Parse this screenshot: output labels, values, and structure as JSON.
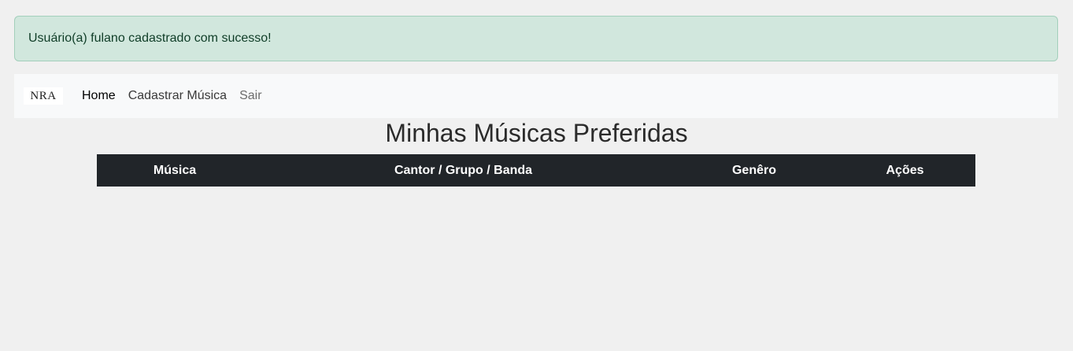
{
  "alert": {
    "message": "Usuário(a) fulano cadastrado com sucesso!"
  },
  "navbar": {
    "brand": "NRA",
    "links": [
      {
        "label": "Home"
      },
      {
        "label": "Cadastrar Música"
      },
      {
        "label": "Sair"
      }
    ]
  },
  "page": {
    "title": "Minhas Músicas Preferidas"
  },
  "table": {
    "headers": [
      "Música",
      "Cantor / Grupo / Banda",
      "Genêro",
      "Ações"
    ]
  },
  "colors": {
    "alert_bg": "#d1e7dd",
    "table_header_bg": "#212529",
    "navbar_bg": "#f8f9fa"
  }
}
